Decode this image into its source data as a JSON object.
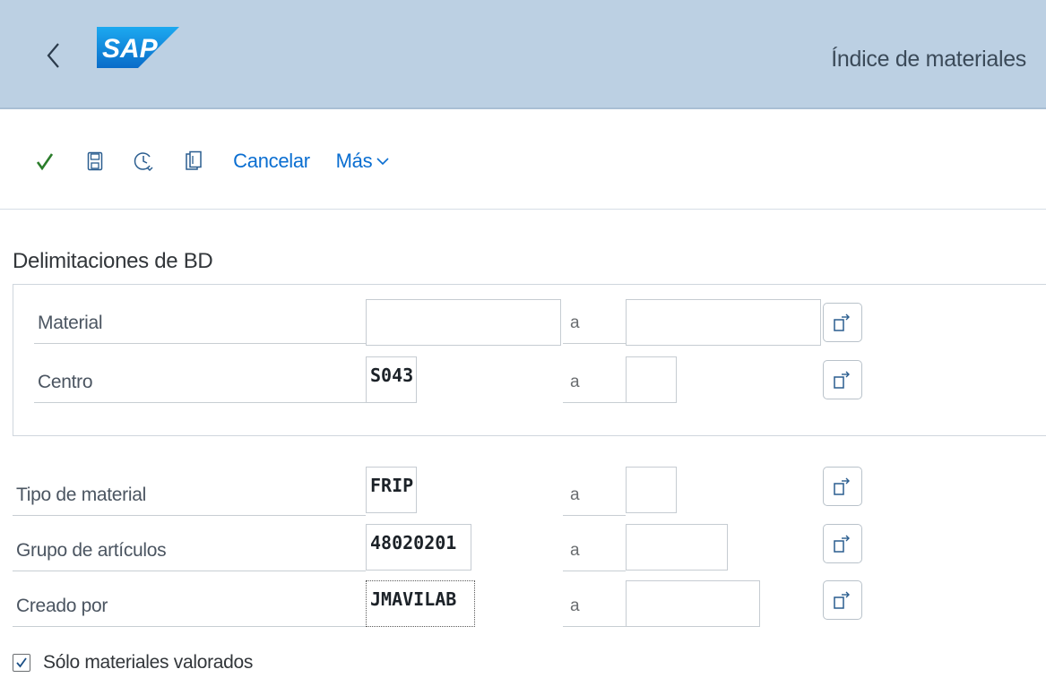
{
  "header": {
    "logo_text": "SAP",
    "title": "Índice de materiales",
    "back_icon": "chevron-left-icon"
  },
  "toolbar": {
    "execute_icon": "checkmark-icon",
    "save_icon": "save-icon",
    "history_icon": "history-icon",
    "copy_icon": "copy-icon",
    "cancel_label": "Cancelar",
    "more_label": "Más",
    "more_icon": "chevron-down-icon"
  },
  "section": {
    "title": "Delimitaciones de BD"
  },
  "range_separator": "a",
  "fields": [
    {
      "label": "Material",
      "from": "",
      "to": ""
    },
    {
      "label": "Centro",
      "from": "S043",
      "to": ""
    },
    {
      "label": "Tipo de material",
      "from": "FRIP",
      "to": ""
    },
    {
      "label": "Grupo de artículos",
      "from": "48020201",
      "to": ""
    },
    {
      "label": "Creado por",
      "from": "JMAVILAB",
      "to": ""
    }
  ],
  "checkbox": {
    "label": "Sólo materiales valorados",
    "checked": true
  },
  "colors": {
    "shell": "#bcd0e3",
    "brand": "#0a6ed1",
    "execute": "#2b7d2b"
  }
}
